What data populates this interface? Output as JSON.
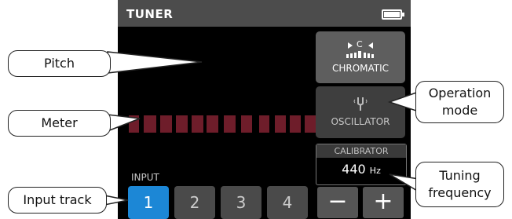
{
  "screen": {
    "title": "TUNER",
    "mode_chromatic_label": "CHROMATIC",
    "mode_chromatic_note": "C",
    "mode_oscillator_label": "OSCILLATOR",
    "calibrator_header": "CALIBRATOR",
    "calibrator_value": "440",
    "calibrator_unit": "Hz",
    "minus_label": "−",
    "plus_label": "+",
    "input_label": "INPUT",
    "tracks": [
      "1",
      "2",
      "3",
      "4"
    ],
    "selected_track": "1"
  },
  "callouts": {
    "pitch": "Pitch",
    "meter": "Meter",
    "input_track": "Input track",
    "operation_mode_line1": "Operation",
    "operation_mode_line2": "mode",
    "tuning_frequency_line1": "Tuning",
    "tuning_frequency_line2": "frequency"
  },
  "colors": {
    "meter_segment": "#6e1d2a",
    "meter_center": "#3d9a3f",
    "selected_track": "#1c87d6"
  }
}
